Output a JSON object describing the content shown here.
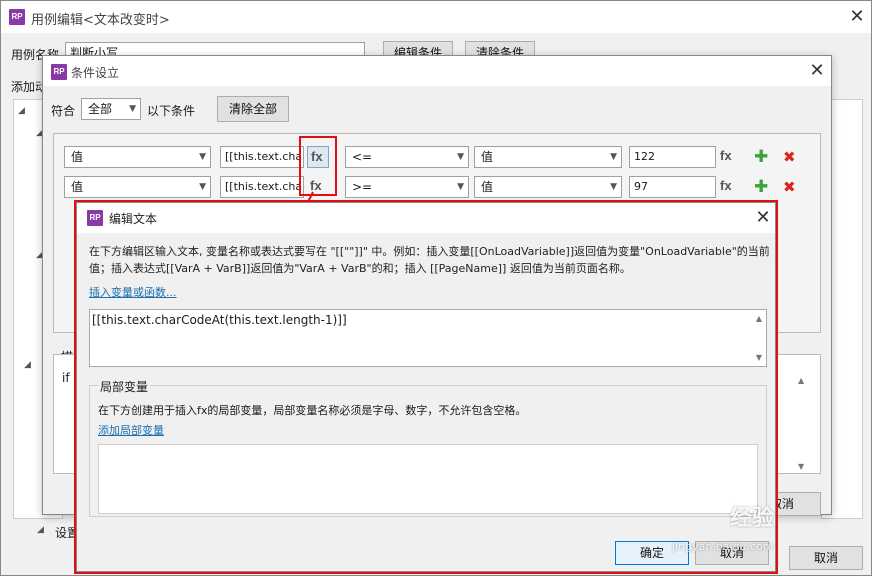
{
  "outer_window": {
    "title": "用例编辑<文本改变时>",
    "case_name_label": "用例名称",
    "case_name_value": "判断小写",
    "edit_condition_label": "编辑条件",
    "clear_condition_label": "清除条件",
    "add_action_label": "添加动",
    "desc_label": "描",
    "if_text": "if",
    "settings_label": "设置",
    "cancel_label": "取消"
  },
  "condition_window": {
    "title": "条件设立",
    "match_label": "符合",
    "match_value": "全部",
    "following_label": "以下条件",
    "clear_all_label": "清除全部",
    "rows": [
      {
        "left_type": "值",
        "expr": "[[this.text.charCo",
        "operator": "<=",
        "right_type": "值",
        "value": "122"
      },
      {
        "left_type": "值",
        "expr": "[[this.text.charCo",
        "operator": ">=",
        "right_type": "值",
        "value": "97"
      }
    ],
    "fx_label": "fx",
    "cancel_partial": "取消"
  },
  "edit_text_window": {
    "title": "编辑文本",
    "instruction": "在下方编辑区输入文本, 变量名称或表达式要写在 \"[[\"\"]]\" 中。例如：插入变量[[OnLoadVariable]]返回值为变量\"OnLoadVariable\"的当前值；插入表达式[[VarA + VarB]]返回值为\"VarA + VarB\"的和；插入 [[PageName]] 返回值为当前页面名称。",
    "insert_link": "插入变量或函数...",
    "editor_text": "[[this.text.charCodeAt(this.text.length-1)]]",
    "local_vars_title": "局部变量",
    "local_vars_desc": "在下方创建用于插入fx的局部变量，局部变量名称必须是字母、数字，不允许包含空格。",
    "add_local_var_link": "添加局部变量",
    "ok_label": "确定",
    "cancel_label": "取消"
  },
  "watermark": {
    "text": "经验",
    "url": "jingyan.baidu.com"
  },
  "colors": {
    "highlight_red": "#e01010",
    "rp_purple": "#8a3aa6",
    "add_green": "#3aa43a",
    "delete_red": "#d9261c",
    "link_blue": "#1a6fb0"
  }
}
